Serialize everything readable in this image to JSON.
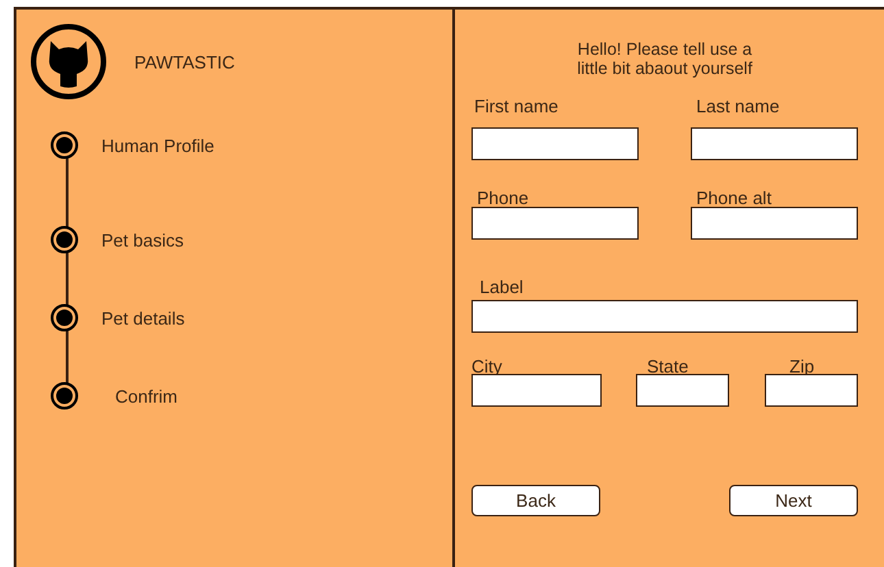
{
  "brand": {
    "name": "PAWTASTIC"
  },
  "steps": [
    {
      "label": "Human Profile"
    },
    {
      "label": "Pet basics"
    },
    {
      "label": "Pet details"
    },
    {
      "label": "Confrim"
    }
  ],
  "form": {
    "intro": [
      "Hello! Please tell use a",
      "little bit abaout yourself"
    ],
    "rows": [
      [
        {
          "label": "First name"
        },
        {
          "label": "Last name"
        }
      ],
      [
        {
          "label": "Phone"
        },
        {
          "label": "Phone alt"
        }
      ],
      [
        {
          "label": "Label"
        }
      ],
      [
        {
          "label": "City"
        },
        {
          "label": "State"
        },
        {
          "label": "Zip"
        }
      ]
    ],
    "buttons": [
      {
        "label": "Back"
      },
      {
        "label": "Next"
      }
    ]
  }
}
